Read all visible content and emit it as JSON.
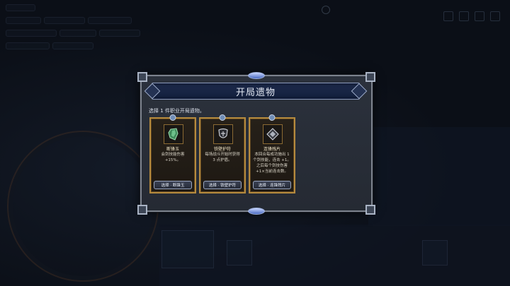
{
  "dialog": {
    "title": "开局遗物",
    "subtitle": "选择 1 件职业开局遗物。"
  },
  "relics": [
    {
      "icon": "jade-shard-icon",
      "name": "断锋玉",
      "desc": "会剑技能伤害 +15%。",
      "button": "选择 · 断锋玉"
    },
    {
      "icon": "iron-shield-icon",
      "name": "铁壁护符",
      "desc": "每场战斗开始时获得 3 点护盾。",
      "button": "选择 · 铁壁护符"
    },
    {
      "icon": "blade-fragment-icon",
      "name": "连锋残片",
      "desc": "本回合每成功施出 1 个剑技能，连击 +1。之后每个剑技伤害 +1×当前连击数。",
      "button": "选择 · 连锋残片"
    }
  ]
}
